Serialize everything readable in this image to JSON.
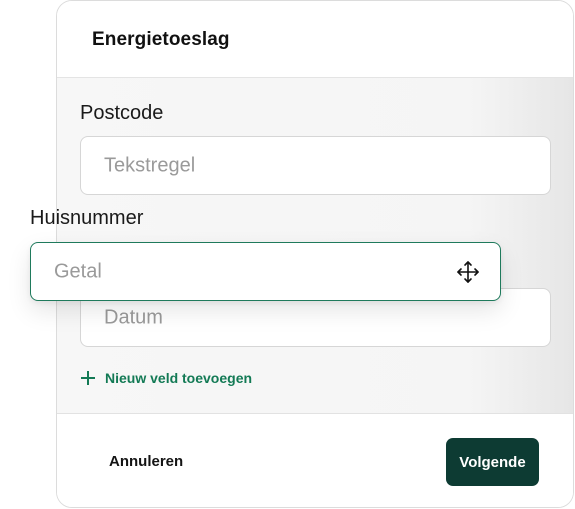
{
  "dialog": {
    "title": "Energietoeslag"
  },
  "fields": [
    {
      "label": "Postcode",
      "placeholder": "Tekstregel"
    },
    {
      "label": "",
      "placeholder": "Datum"
    }
  ],
  "dragged_field": {
    "label": "Huisnummer",
    "placeholder": "Getal",
    "icon": "move-icon"
  },
  "add_field": {
    "label": "Nieuw veld toevoegen",
    "icon": "plus-icon"
  },
  "footer": {
    "cancel_label": "Annuleren",
    "next_label": "Volgende"
  },
  "colors": {
    "accent": "#137a55",
    "primary_button": "#0d3b33",
    "drag_border": "#1f7a5c"
  }
}
